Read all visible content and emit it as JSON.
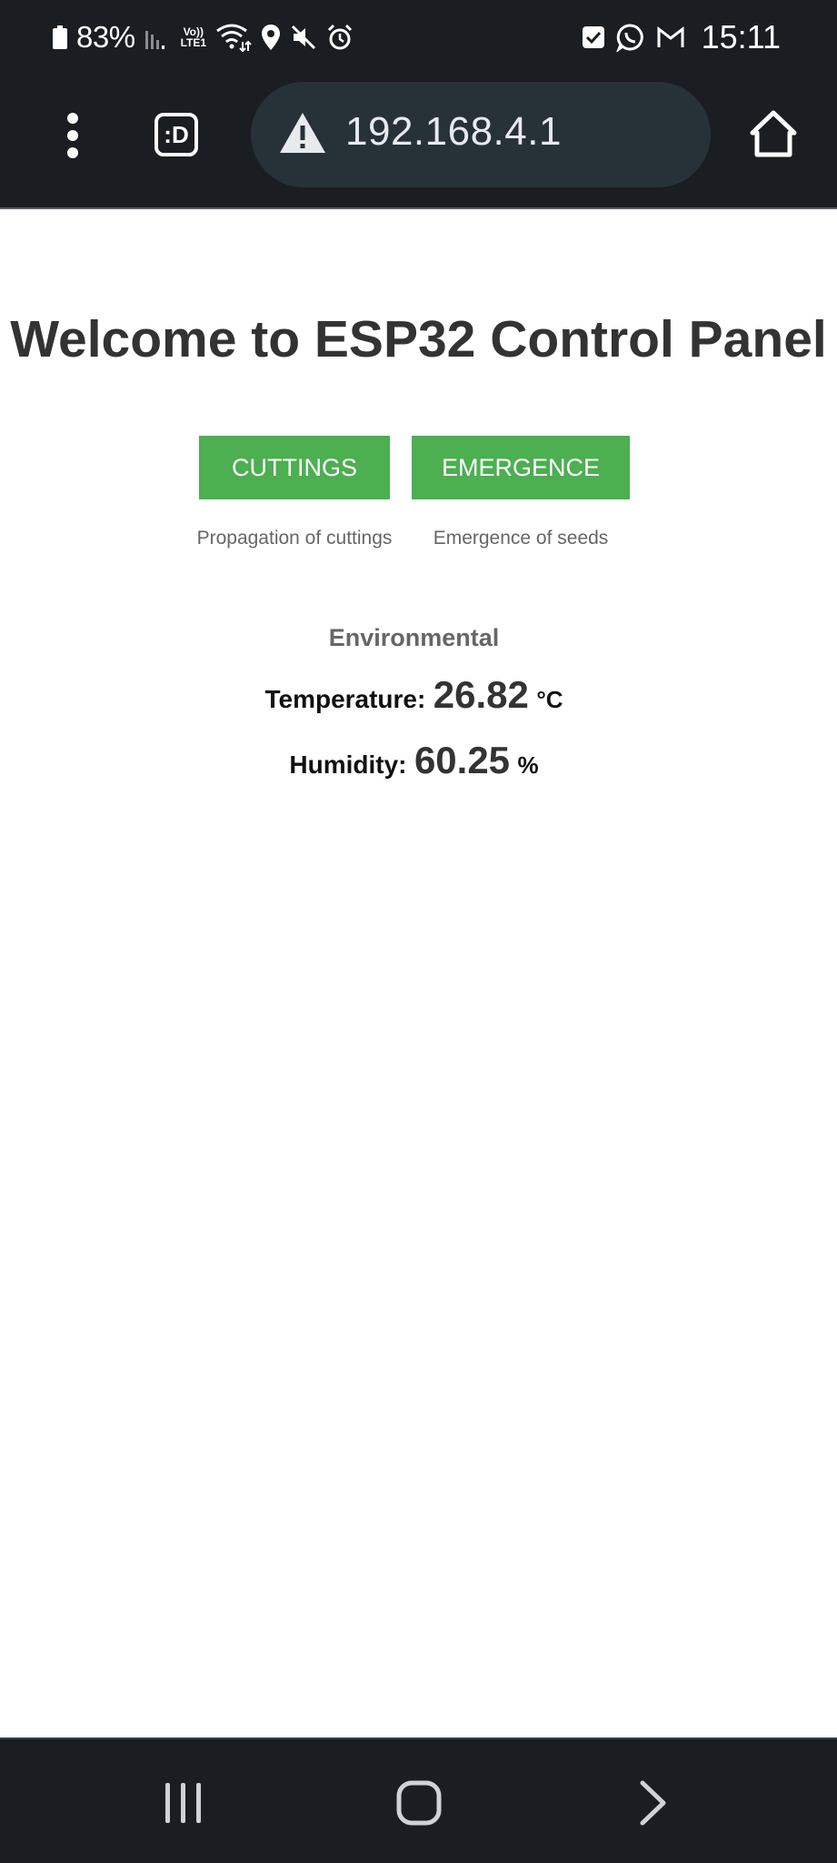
{
  "status_bar": {
    "battery_percent": "83%",
    "volte_line1": "Vo))",
    "volte_line2": "LTE1",
    "time": "15:11",
    "left_icons": [
      "battery-icon",
      "signal-icon",
      "volte-icon",
      "wifi-icon",
      "location-icon",
      "mute-icon",
      "alarm-icon"
    ],
    "right_icons": [
      "checkbox-notification-icon",
      "whatsapp-icon",
      "gmail-icon"
    ]
  },
  "browser": {
    "tab_label": ":D",
    "url": "192.168.4.1",
    "security_icon": "warning-icon"
  },
  "page": {
    "title": "Welcome to ESP32 Control Panel",
    "buttons": [
      {
        "label": "CUTTINGS",
        "caption": "Propagation of cuttings"
      },
      {
        "label": "EMERGENCE",
        "caption": "Emergence of seeds"
      }
    ],
    "environment": {
      "heading": "Environmental",
      "temperature_label": "Temperature:",
      "temperature_value": "26.82",
      "temperature_unit": "°C",
      "humidity_label": "Humidity:",
      "humidity_value": "60.25",
      "humidity_unit": "%"
    }
  },
  "colors": {
    "button_green": "#4caf50",
    "chrome_dark": "#1a1d21",
    "url_bar": "#263238"
  },
  "nav_bar": {
    "icons": [
      "recents-icon",
      "home-icon",
      "back-icon"
    ]
  }
}
